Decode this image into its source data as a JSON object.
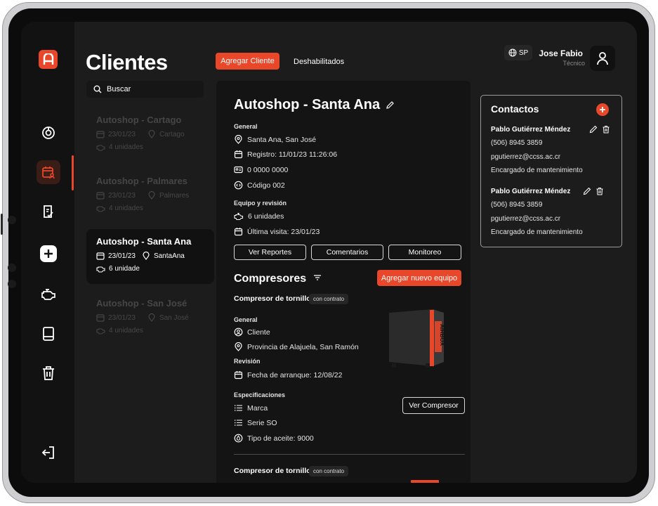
{
  "header": {
    "title": "Clientes",
    "add_client_label": "Agregar Cliente",
    "disabled_tab_label": "Deshabilitados",
    "language": "SP",
    "user_name": "Jose Fabio",
    "user_role": "Técnico"
  },
  "search": {
    "placeholder": "Buscar"
  },
  "clients": [
    {
      "name": "Autoshop - Cartago",
      "date": "23/01/23",
      "location": "Cartago",
      "units": "4 unidades"
    },
    {
      "name": "Autoshop - Palmares",
      "date": "23/01/23",
      "location": "Palmares",
      "units": "4 unidades"
    },
    {
      "name": "Autoshop - Santa Ana",
      "date": "23/01/23",
      "location": "SantaAna",
      "units": "6 unidade"
    },
    {
      "name": "Autoshop - San José",
      "date": "23/01/23",
      "location": "San José",
      "units": "4 unidades"
    }
  ],
  "detail": {
    "name": "Autoshop - Santa Ana",
    "general_label": "General",
    "address": "Santa Ana, San José",
    "registro": "Registro: 11/01/23 11:26:06",
    "id_number": "0 0000 0000",
    "code": "Código 002",
    "equipment_label": "Equipo y revisión",
    "units": "6 unidades",
    "last_visit": "Última visita: 23/01/23",
    "buttons": {
      "reports": "Ver Reportes",
      "comments": "Comentarios",
      "monitor": "Monitoreo"
    }
  },
  "compressors": {
    "title": "Compresores",
    "add_label": "Agregar nuevo equipo",
    "items": [
      {
        "type": "Compresor de tornillo",
        "badge": "con contrato",
        "general_label": "General",
        "client": "Cliente",
        "province": "Provincia de Alajuela, San Ramón",
        "revision_label": "Revisión",
        "start_date": "Fecha de arranque: 12/08/22",
        "specs_label": "Especificaciones",
        "brand": "Marca",
        "serie": "Serie SO",
        "oil": "Tipo de aceite: 9000",
        "view_label": "Ver Compresor",
        "image_brand": "AIRBOX"
      },
      {
        "type": "Compresor de tornillo",
        "badge": "con contrato"
      }
    ]
  },
  "contacts": {
    "title": "Contactos",
    "items": [
      {
        "name": "Pablo Gutiérrez Méndez",
        "phone": "(506) 8945 3859",
        "email": "pgutierrez@ccss.ac.cr",
        "role": "Encargado de mantenimiento"
      },
      {
        "name": "Pablo Gutiérrez Méndez",
        "phone": "(506) 8945 3859",
        "email": "pgutierrez@ccss.ac.cr",
        "role": "Encargado de mantenimiento"
      }
    ]
  },
  "colors": {
    "accent": "#e8472a",
    "background": "#1c1c1c",
    "panel": "#141414",
    "sidebar": "#121212"
  }
}
